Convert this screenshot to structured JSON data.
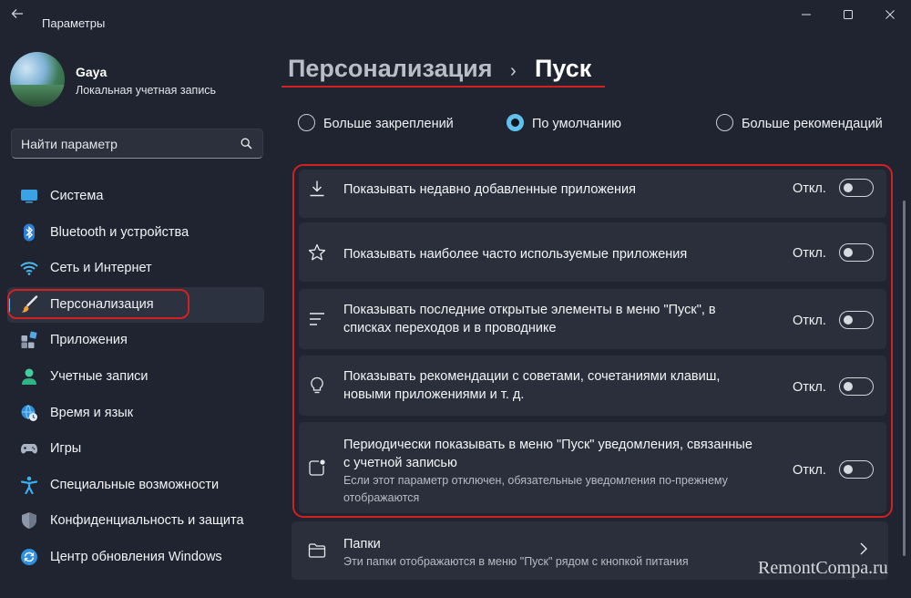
{
  "window": {
    "title": "Параметры",
    "controls": {
      "minimize": "—",
      "maximize": "☐",
      "close": "✕"
    }
  },
  "user": {
    "name": "Gaya",
    "account_type": "Локальная учетная запись"
  },
  "search": {
    "placeholder": "Найти параметр"
  },
  "sidebar": {
    "items": [
      {
        "label": "Система",
        "icon": "monitor-icon"
      },
      {
        "label": "Bluetooth и устройства",
        "icon": "bluetooth-icon"
      },
      {
        "label": "Сеть и Интернет",
        "icon": "wifi-icon"
      },
      {
        "label": "Персонализация",
        "icon": "brush-icon",
        "active": true
      },
      {
        "label": "Приложения",
        "icon": "apps-icon"
      },
      {
        "label": "Учетные записи",
        "icon": "person-icon"
      },
      {
        "label": "Время и язык",
        "icon": "globe-clock-icon"
      },
      {
        "label": "Игры",
        "icon": "gamepad-icon"
      },
      {
        "label": "Специальные возможности",
        "icon": "accessibility-icon"
      },
      {
        "label": "Конфиденциальность и защита",
        "icon": "shield-icon"
      },
      {
        "label": "Центр обновления Windows",
        "icon": "update-icon"
      }
    ]
  },
  "breadcrumb": {
    "parent": "Персонализация",
    "separator": "›",
    "current": "Пуск"
  },
  "layout_options": [
    {
      "label": "Больше закреплений",
      "checked": false
    },
    {
      "label": "По умолчанию",
      "checked": true
    },
    {
      "label": "Больше рекомендаций",
      "checked": false
    }
  ],
  "settings": [
    {
      "title": "Показывать недавно добавленные приложения",
      "state": "Откл.",
      "icon": "download-icon"
    },
    {
      "title": "Показывать наиболее часто используемые приложения",
      "state": "Откл.",
      "icon": "star-icon"
    },
    {
      "title": "Показывать последние открытые элементы в меню \"Пуск\", в списках переходов и в проводнике",
      "state": "Откл.",
      "icon": "list-icon"
    },
    {
      "title": "Показывать рекомендации с советами, сочетаниями клавиш, новыми приложениями и т. д.",
      "state": "Откл.",
      "icon": "lightbulb-icon"
    },
    {
      "title": "Периодически показывать в меню \"Пуск\" уведомления, связанные с учетной записью",
      "description": "Если этот параметр отключен, обязательные уведомления по-прежнему отображаются",
      "state": "Откл.",
      "icon": "notification-icon"
    }
  ],
  "folders": {
    "title": "Папки",
    "description": "Эти папки отображаются в меню \"Пуск\" рядом с кнопкой питания"
  },
  "watermark": "RemontCompa.ru"
}
